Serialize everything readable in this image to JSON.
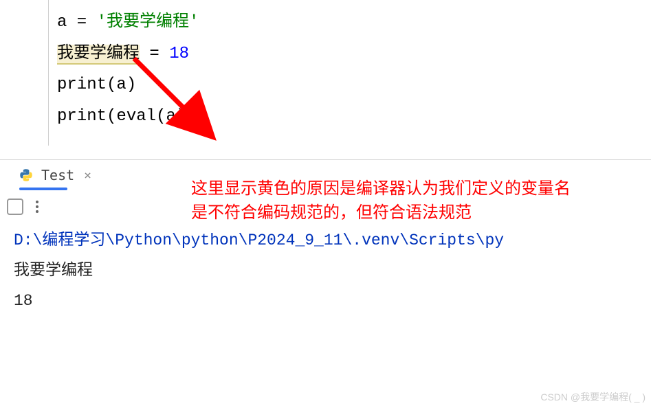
{
  "code": {
    "line1_var": "a",
    "line1_op": " = ",
    "line1_str": "'我要学编程'",
    "line2_var": "我要学编程",
    "line2_op": " = ",
    "line2_num": "18",
    "line3_func": "print",
    "line3_arg": "a",
    "line4_func_outer": "print",
    "line4_func_inner": "eval",
    "line4_arg": "a"
  },
  "tab": {
    "label": "Test",
    "close": "×"
  },
  "annotation": {
    "text": "这里显示黄色的原因是编译器认为我们定义的变量名是不符合编码规范的，但符合语法规范"
  },
  "console": {
    "path": "D:\\编程学习\\Python\\python\\P2024_9_11\\.venv\\Scripts\\py",
    "out1": "我要学编程",
    "out2": "18"
  },
  "watermark": "CSDN @我要学编程( _ )"
}
